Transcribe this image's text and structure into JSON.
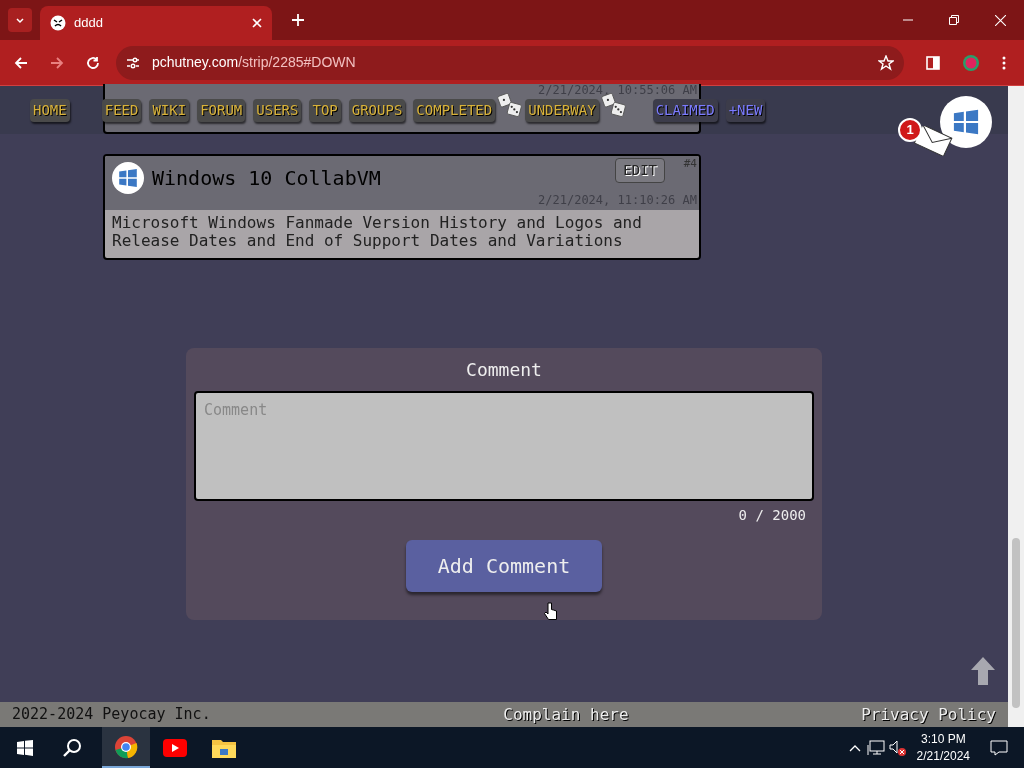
{
  "browser": {
    "tab_title": "dddd",
    "address_host": "pchutney.com",
    "address_path": "/strip/2285#DOWN"
  },
  "nav": [
    {
      "label": "HOME",
      "kind": "gold"
    },
    {
      "label": "FEED",
      "kind": "gold"
    },
    {
      "label": "WIKI",
      "kind": "gold"
    },
    {
      "label": "FORUM",
      "kind": "gold"
    },
    {
      "label": "USERS",
      "kind": "gold"
    },
    {
      "label": "TOP",
      "kind": "gold"
    },
    {
      "label": "GROUPS",
      "kind": "gold"
    },
    {
      "label": "COMPLETED",
      "kind": "gold",
      "dice": true
    },
    {
      "label": "UNDERWAY",
      "kind": "gold",
      "dice": true
    },
    {
      "label": "CLAIMED",
      "kind": "blue"
    },
    {
      "label": "+NEW",
      "kind": "blue"
    }
  ],
  "notification_count": "1",
  "previous_card": {
    "timestamp": "2/21/2024, 10:55:06 AM"
  },
  "card": {
    "number": "#4",
    "title": "Windows 10 CollabVM",
    "edit": "EDIT",
    "timestamp": "2/21/2024, 11:10:26 AM",
    "description": "Microsoft Windows Fanmade Version History and Logos and Release Dates and End of Support Dates and Variations"
  },
  "comment": {
    "heading": "Comment",
    "placeholder": "Comment",
    "counter": "0 / 2000",
    "button": "Add Comment"
  },
  "footer": {
    "copyright": "2022-2024 Peyocay Inc.",
    "complain": "Complain here",
    "privacy": "Privacy Policy"
  },
  "taskbar": {
    "time": "3:10 PM",
    "date": "2/21/2024"
  }
}
